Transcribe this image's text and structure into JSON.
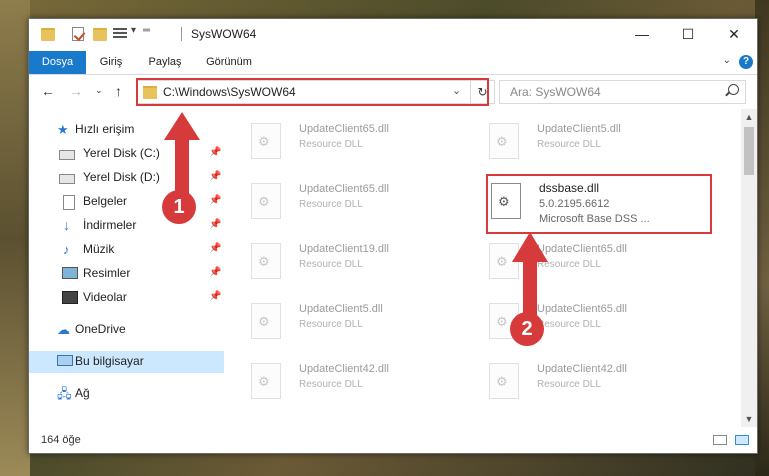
{
  "window": {
    "title": "SysWOW64",
    "controls": {
      "minimize": "—",
      "maximize": "☐",
      "close": "✕"
    }
  },
  "ribbon": {
    "tabs": [
      "Dosya",
      "Giriş",
      "Paylaş",
      "Görünüm"
    ],
    "help": "?"
  },
  "navbar": {
    "address": "C:\\Windows\\SysWOW64",
    "search_placeholder": "Ara: SysWOW64"
  },
  "sidebar": {
    "quick_access": "Hızlı erişim",
    "items": [
      {
        "label": "Yerel Disk (C:)",
        "icon": "drive-icon",
        "pinned": true
      },
      {
        "label": "Yerel Disk (D:)",
        "icon": "drive-icon",
        "pinned": true
      },
      {
        "label": "Belgeler",
        "icon": "documents-icon",
        "pinned": true
      },
      {
        "label": "İndirmeler",
        "icon": "download-icon",
        "pinned": true
      },
      {
        "label": "Müzik",
        "icon": "music-icon",
        "pinned": true
      },
      {
        "label": "Resimler",
        "icon": "pictures-icon",
        "pinned": true
      },
      {
        "label": "Videolar",
        "icon": "videos-icon",
        "pinned": true
      }
    ],
    "onedrive": "OneDrive",
    "this_pc": "Bu bilgisayar",
    "network": "Ağ"
  },
  "files": [
    {
      "name": "UpdateClient65.dll",
      "type": "Resource DLL"
    },
    {
      "name": "UpdateClient5.dll",
      "type": "Resource DLL"
    },
    {
      "name": "UpdateClient65.dll",
      "type": "Resource DLL"
    },
    {
      "name": "dssbase.dll",
      "version": "5.0.2195.6612",
      "description": "Microsoft Base DSS ..."
    },
    {
      "name": "UpdateClient19.dll",
      "type": "Resource DLL"
    },
    {
      "name": "UpdateClient65.dll",
      "type": "Resource DLL"
    },
    {
      "name": "UpdateClient5.dll",
      "type": "Resource DLL"
    },
    {
      "name": "UpdateClient65.dll",
      "type": "Resource DLL"
    },
    {
      "name": "UpdateClient42.dll",
      "type": "Resource DLL"
    },
    {
      "name": "UpdateClient42.dll",
      "type": "Resource DLL"
    }
  ],
  "status": {
    "item_count": "164 öğe"
  },
  "annotations": {
    "step1": "1",
    "step2": "2",
    "color": "#d63a3a"
  }
}
